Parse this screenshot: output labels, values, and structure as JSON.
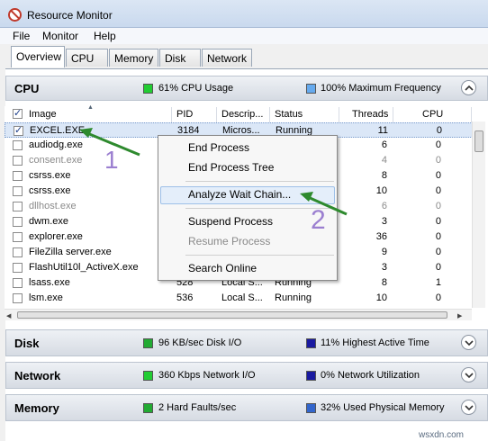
{
  "window": {
    "title": "Resource Monitor"
  },
  "menu": [
    "File",
    "Monitor",
    "Help"
  ],
  "tabs": [
    "Overview",
    "CPU",
    "Memory",
    "Disk",
    "Network"
  ],
  "cpu": {
    "title": "CPU",
    "indicator1_text": "61% CPU Usage",
    "indicator1_color": "#22cc33",
    "indicator2_text": "100% Maximum Frequency",
    "indicator2_color": "#66aaee",
    "columns": [
      "Image",
      "PID",
      "Descrip...",
      "Status",
      "Threads",
      "CPU"
    ],
    "rows": [
      {
        "image": "EXCEL.EXE",
        "pid": "3184",
        "desc": "Micros...",
        "status": "Running",
        "threads": "11",
        "cpu": "0",
        "checked": true
      },
      {
        "image": "audiodg.exe",
        "pid": "",
        "desc": "",
        "status": "",
        "threads": "6",
        "cpu": "0"
      },
      {
        "image": "consent.exe",
        "pid": "",
        "desc": "",
        "status": "",
        "threads": "4",
        "cpu": "0"
      },
      {
        "image": "csrss.exe",
        "pid": "",
        "desc": "",
        "status": "",
        "threads": "8",
        "cpu": "0"
      },
      {
        "image": "csrss.exe",
        "pid": "",
        "desc": "",
        "status": "",
        "threads": "10",
        "cpu": "0"
      },
      {
        "image": "dllhost.exe",
        "pid": "",
        "desc": "",
        "status": "",
        "threads": "6",
        "cpu": "0"
      },
      {
        "image": "dwm.exe",
        "pid": "",
        "desc": "",
        "status": "",
        "threads": "3",
        "cpu": "0"
      },
      {
        "image": "explorer.exe",
        "pid": "",
        "desc": "",
        "status": "",
        "threads": "36",
        "cpu": "0"
      },
      {
        "image": "FileZilla server.exe",
        "pid": "",
        "desc": "",
        "status": "",
        "threads": "9",
        "cpu": "0"
      },
      {
        "image": "FlashUtil10l_ActiveX.exe",
        "pid": "",
        "desc": "",
        "status": "",
        "threads": "3",
        "cpu": "0"
      },
      {
        "image": "lsass.exe",
        "pid": "528",
        "desc": "Local S...",
        "status": "Running",
        "threads": "8",
        "cpu": "1"
      },
      {
        "image": "lsm.exe",
        "pid": "536",
        "desc": "Local S...",
        "status": "Running",
        "threads": "10",
        "cpu": "0"
      }
    ]
  },
  "context_menu": [
    "End Process",
    "End Process Tree",
    "Analyze Wait Chain...",
    "Suspend Process",
    "Resume Process",
    "Search Online"
  ],
  "annotations": [
    "1",
    "2"
  ],
  "disk": {
    "title": "Disk",
    "indicator1_text": "96 KB/sec Disk I/O",
    "indicator1_color": "#22aa33",
    "indicator2_text": "11% Highest Active Time",
    "indicator2_color": "#1a1aa0"
  },
  "network": {
    "title": "Network",
    "indicator1_text": "360 Kbps Network I/O",
    "indicator1_color": "#22cc33",
    "indicator2_text": "0% Network Utilization",
    "indicator2_color": "#1a1aa0"
  },
  "memory": {
    "title": "Memory",
    "indicator1_text": "2 Hard Faults/sec",
    "indicator1_color": "#22aa33",
    "indicator2_text": "32% Used Physical Memory",
    "indicator2_color": "#3366cc"
  },
  "watermark": "wsxdn.com"
}
